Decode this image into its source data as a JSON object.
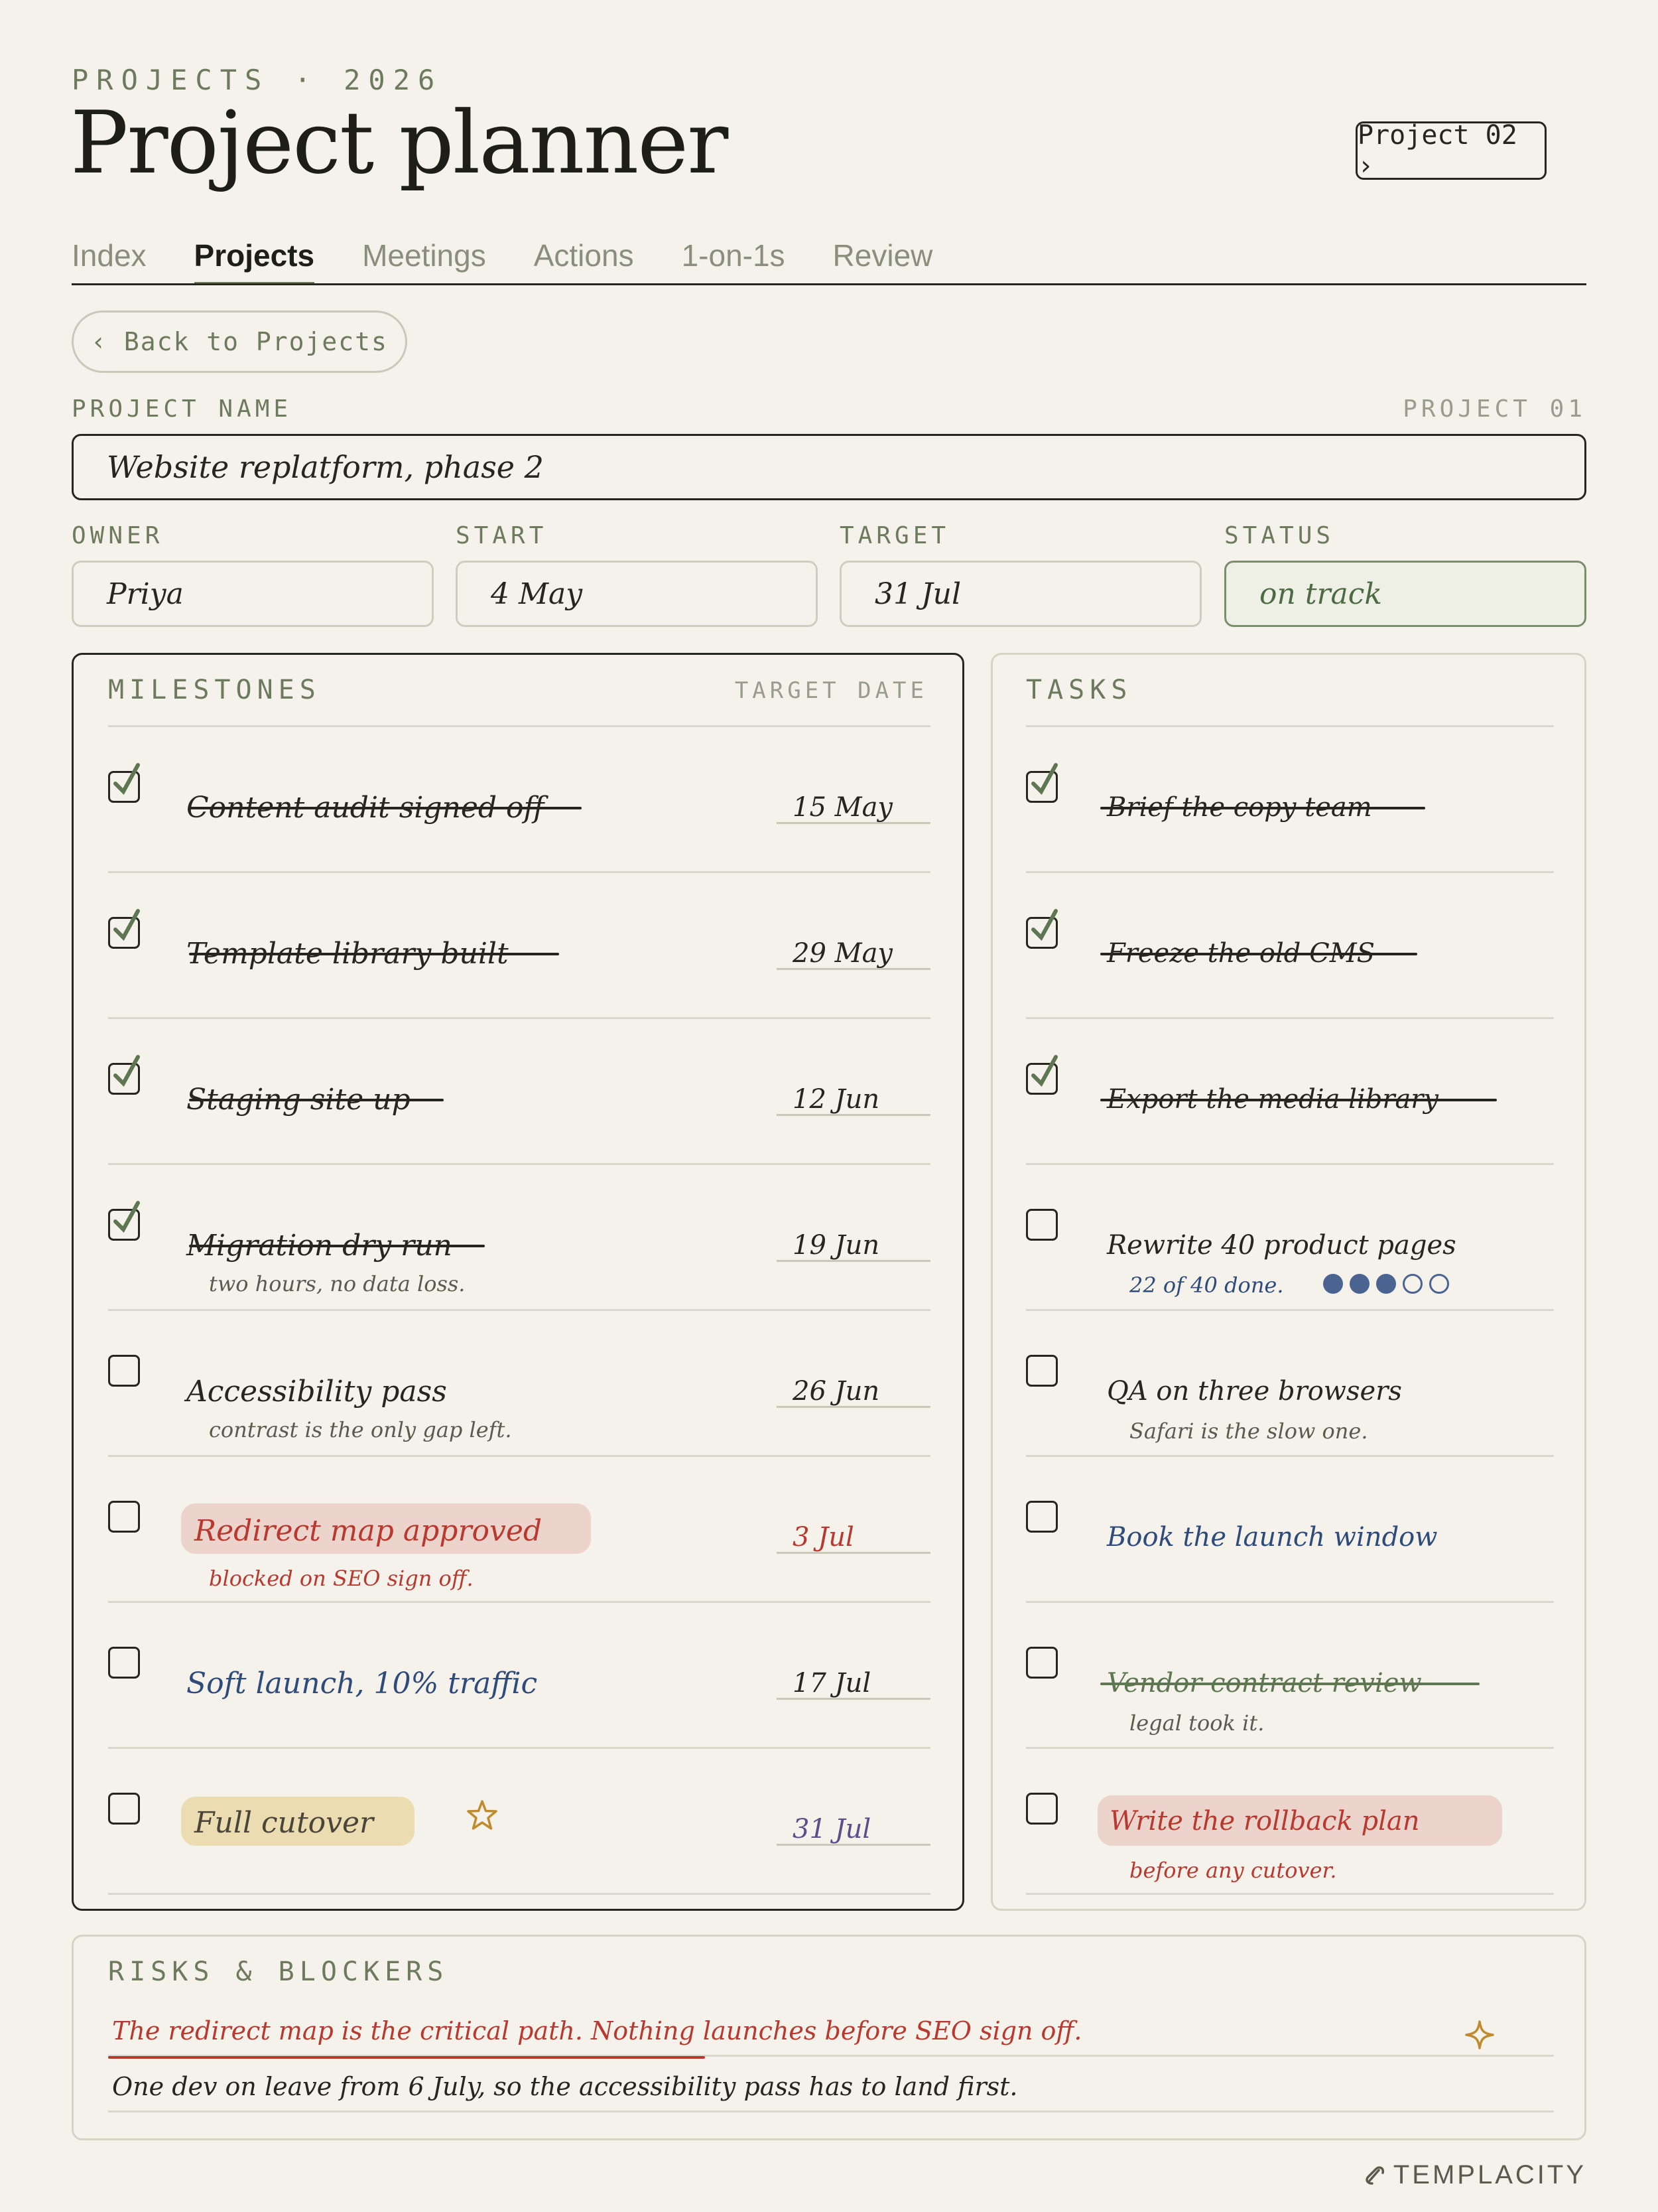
{
  "header": {
    "eyebrow": "PROJECTS · 2026",
    "title": "Project planner",
    "next_project": "Project 02 ›"
  },
  "tabs": [
    {
      "label": "Index",
      "active": false
    },
    {
      "label": "Projects",
      "active": true
    },
    {
      "label": "Meetings",
      "active": false
    },
    {
      "label": "Actions",
      "active": false
    },
    {
      "label": "1-on-1s",
      "active": false
    },
    {
      "label": "Review",
      "active": false
    }
  ],
  "back_label": "‹ Back to Projects",
  "project": {
    "name_label": "PROJECT NAME",
    "number_label": "PROJECT 01",
    "name": "Website replatform, phase 2",
    "owner_label": "OWNER",
    "owner": "Priya",
    "start_label": "START",
    "start": "4 May",
    "target_label": "TARGET",
    "target": "31 Jul",
    "status_label": "STATUS",
    "status": "on track"
  },
  "milestones": {
    "title": "MILESTONES",
    "date_header": "TARGET DATE",
    "items": [
      {
        "text": "Content audit signed off",
        "date": "15 May",
        "done": true
      },
      {
        "text": "Template library built",
        "date": "29 May",
        "done": true
      },
      {
        "text": "Staging site up",
        "date": "12 Jun",
        "done": true
      },
      {
        "text": "Migration dry run",
        "date": "19 Jun",
        "done": true,
        "note": "two hours, no data loss."
      },
      {
        "text": "Accessibility pass",
        "date": "26 Jun",
        "done": false,
        "note": "contrast is the only gap left."
      },
      {
        "text": "Redirect map approved",
        "date": "3 Jul",
        "done": false,
        "note": "blocked on SEO sign off.",
        "style": "blocked"
      },
      {
        "text": "Soft launch, 10% traffic",
        "date": "17 Jul",
        "done": false,
        "style": "blue"
      },
      {
        "text": "Full cutover",
        "date": "31 Jul",
        "done": false,
        "style": "highlight",
        "star": true
      }
    ]
  },
  "tasks": {
    "title": "TASKS",
    "items": [
      {
        "text": "Brief the copy team",
        "done": true
      },
      {
        "text": "Freeze the old CMS",
        "done": true
      },
      {
        "text": "Export the media library",
        "done": true
      },
      {
        "text": "Rewrite 40 product pages",
        "done": false,
        "note": "22 of 40 done.",
        "progress": {
          "filled": 3,
          "total": 5
        }
      },
      {
        "text": "QA on three browsers",
        "done": false,
        "note": "Safari is the slow one."
      },
      {
        "text": "Book the launch window",
        "done": false,
        "style": "blue"
      },
      {
        "text": "Vendor contract review",
        "done": false,
        "style": "struck",
        "note": "legal took it."
      },
      {
        "text": "Write the rollback plan",
        "done": false,
        "style": "blocked",
        "note": "before any cutover."
      }
    ]
  },
  "risks": {
    "title": "RISKS & BLOCKERS",
    "lines": [
      "The redirect map is the critical path. Nothing launches before SEO sign off.",
      "One dev on leave from 6 July, so the accessibility pass has to land first."
    ]
  },
  "brand": "TEMPLACITY",
  "colors": {
    "background": "#f4f2ea",
    "accent_green": "#6e7a5e",
    "blocked_red": "#b8392f",
    "note_blue": "#2e4b7c",
    "highlight_yellow": "#ebdcb1",
    "highlight_red": "#ecd3cc"
  }
}
